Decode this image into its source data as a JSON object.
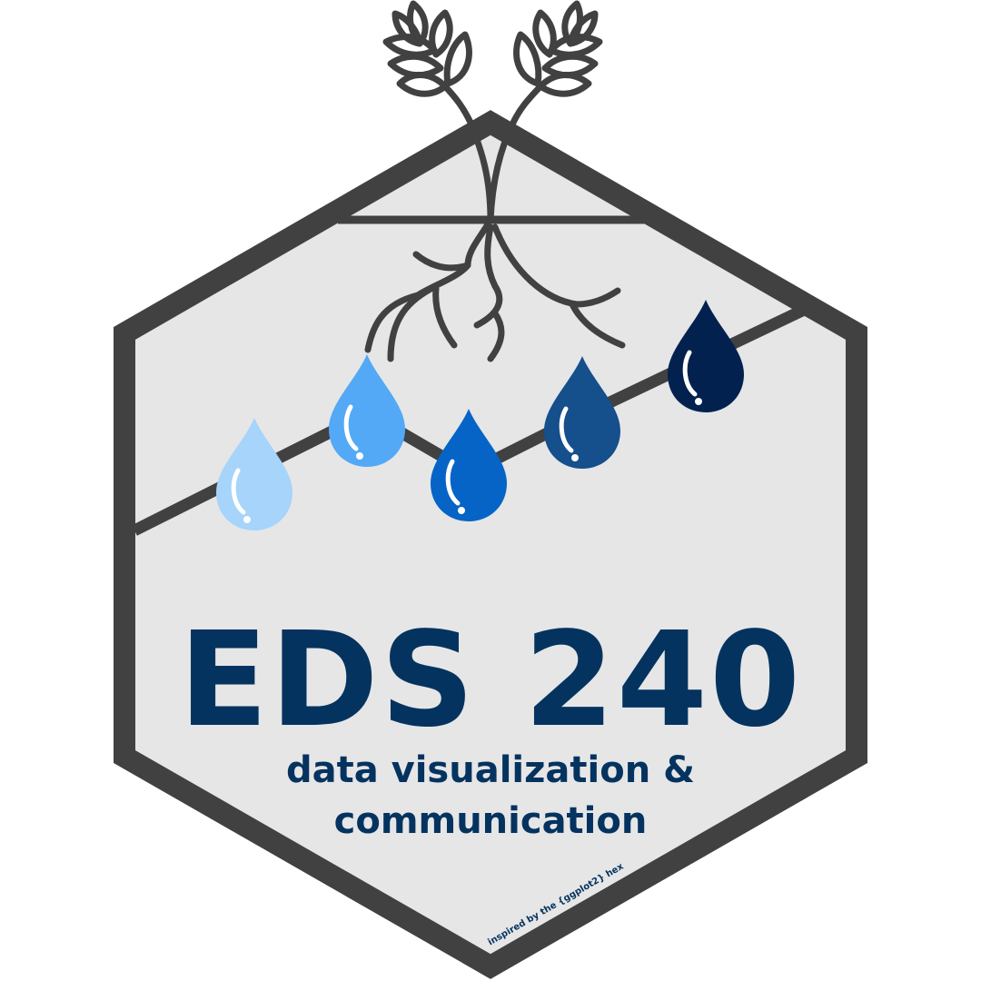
{
  "sticker": {
    "course_code": "EDS 240",
    "subtitle_line1": "data visualization &",
    "subtitle_line2": "communication",
    "credit": "inspired by the {ggplot2} hex"
  },
  "colors": {
    "hex_fill": "#e6e6e7",
    "hex_border": "#414141",
    "text": "#05335f",
    "drop_1": "#a6d4fb",
    "drop_2": "#53a9f5",
    "drop_3": "#0564c6",
    "drop_4": "#154f8c",
    "drop_5": "#03214f"
  },
  "icons": [
    "sprout-icon",
    "water-drop-icon"
  ]
}
